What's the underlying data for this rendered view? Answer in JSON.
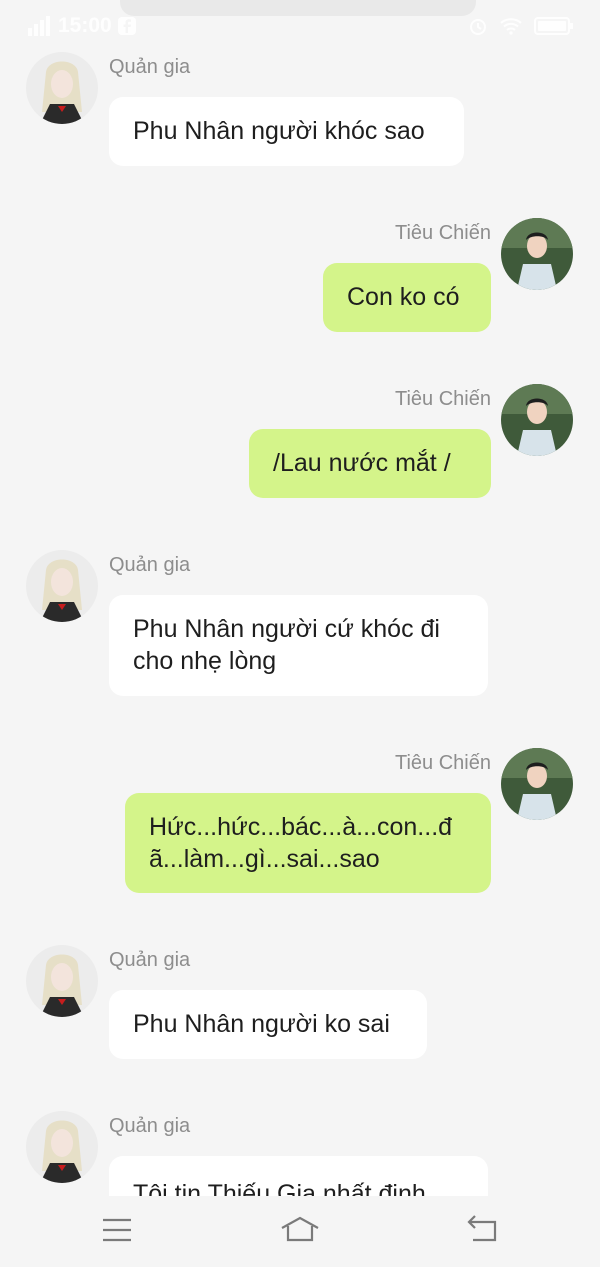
{
  "status": {
    "time": "15:00"
  },
  "messages": [
    {
      "side": "left",
      "name": "Quản gia",
      "text": "Phu Nhân người khóc sao"
    },
    {
      "side": "right",
      "name": "Tiêu Chiến",
      "text": "Con ko có"
    },
    {
      "side": "right",
      "name": "Tiêu Chiến",
      "text": "/Lau nước mắt /"
    },
    {
      "side": "left",
      "name": "Quản gia",
      "text": "Phu Nhân người cứ khóc đi cho nhẹ lòng"
    },
    {
      "side": "right",
      "name": "Tiêu Chiến",
      "text": "Hức...hức...bác...à...con...đã...làm...gì...sai...sao"
    },
    {
      "side": "left",
      "name": "Quản gia",
      "text": "Phu Nhân người ko sai"
    },
    {
      "side": "left",
      "name": "Quản gia",
      "text": "Tôi tin Thiếu Gia nhất định"
    }
  ],
  "nav": {
    "menu_icon": "menu-icon",
    "home_icon": "home-icon",
    "back_icon": "back-icon"
  },
  "colors": {
    "left_bubble": "#ffffff",
    "right_bubble": "#d4f48a",
    "background": "#f5f5f5",
    "name_text": "#8d8d8d"
  }
}
